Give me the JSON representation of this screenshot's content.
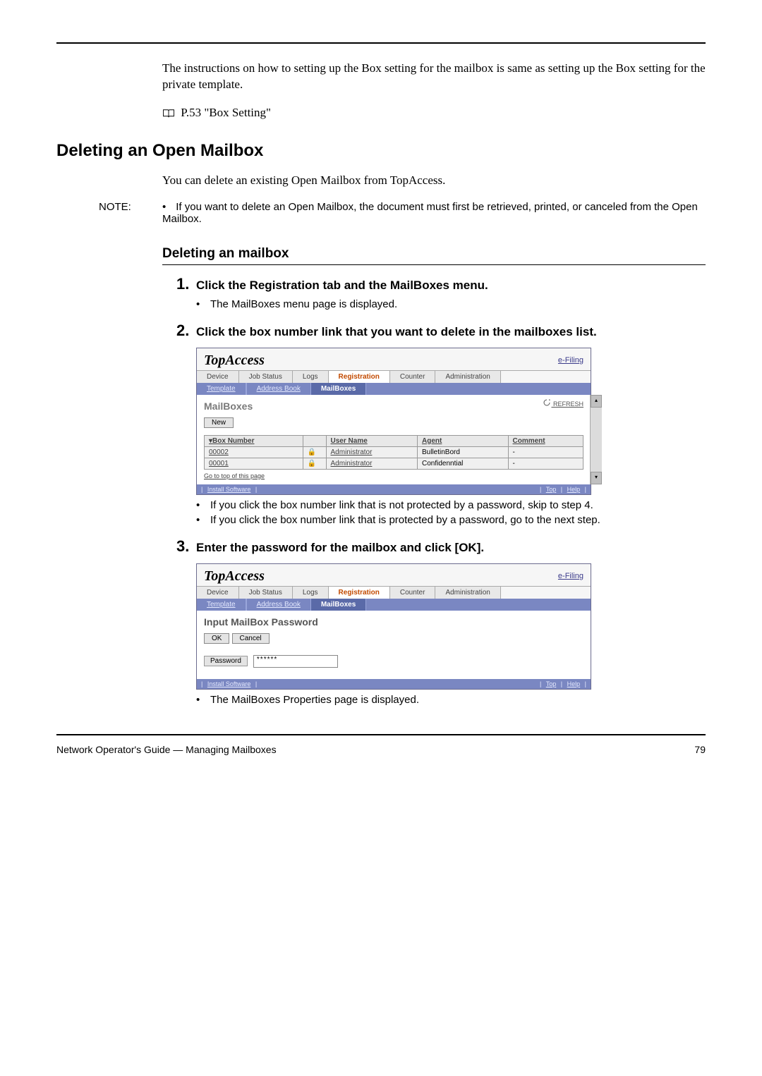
{
  "intro": {
    "para": "The instructions on how to setting up the Box setting for the mailbox is same as setting up the Box setting for the private template.",
    "ref": "P.53 \"Box Setting\""
  },
  "section_title": "Deleting an Open Mailbox",
  "section_para": "You can delete an existing Open Mailbox from TopAccess.",
  "note": {
    "label": "NOTE:",
    "text": "If you want to delete an Open Mailbox, the document must first be retrieved, printed, or canceled from the Open Mailbox."
  },
  "subsection_title": "Deleting an mailbox",
  "step1": {
    "num": "1.",
    "title": "Click the Registration tab and the MailBoxes menu.",
    "sub": "The MailBoxes menu page is displayed."
  },
  "step2": {
    "num": "2.",
    "title": "Click the box number link that you want to delete in the mailboxes list.",
    "sub1": "If you click the box number link that is not protected by a password, skip to step 4.",
    "sub2": "If you click the box number link that is protected by a password, go to the next step."
  },
  "step3": {
    "num": "3.",
    "title": "Enter the password for the mailbox and click [OK].",
    "sub": "The MailBoxes Properties page is displayed."
  },
  "topaccess": {
    "logo": "TopAccess",
    "efiling": "e-Filing",
    "tabs": {
      "device": "Device",
      "job_status": "Job Status",
      "logs": "Logs",
      "registration": "Registration",
      "counter": "Counter",
      "administration": "Administration"
    },
    "subtabs": {
      "template": "Template",
      "address_book": "Address Book",
      "mailboxes": "MailBoxes"
    },
    "body1": {
      "title": "MailBoxes",
      "refresh": "REFRESH",
      "new_btn": "New",
      "th_box": "Box Number",
      "th_user": "User Name",
      "th_agent": "Agent",
      "th_comment": "Comment",
      "rows": [
        {
          "box": "00002",
          "user": "Administrator",
          "agent": "BulletinBord",
          "comment": "-"
        },
        {
          "box": "00001",
          "user": "Administrator",
          "agent": "Confidenntial",
          "comment": "-"
        }
      ],
      "back": "Go to top of this page"
    },
    "body2": {
      "title": "Input MailBox Password",
      "ok": "OK",
      "cancel": "Cancel",
      "pwd_label": "Password",
      "pwd_value": "******"
    },
    "footer": {
      "install": "Install Software",
      "top": "Top",
      "help": "Help"
    }
  },
  "page_footer": {
    "left": "Network Operator's Guide — Managing Mailboxes",
    "right": "79"
  }
}
